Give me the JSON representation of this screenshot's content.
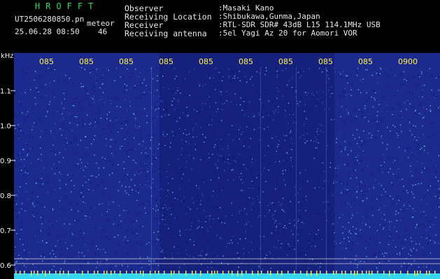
{
  "header": {
    "app_title": "HROFFT",
    "file_name": "UT2506280850.pn",
    "meteor_label": "meteor",
    "timestamp": "25.06.28 08:50",
    "meteor_count": "46",
    "info": [
      {
        "label": "Observer",
        "value": ":Masaki Kano"
      },
      {
        "label": "Receiving Location",
        "value": ":Shibukawa,Gunma,Japan"
      },
      {
        "label": "Receiver",
        "value": ":RTL-SDR SDR# 43dB L15 114.1MHz USB"
      },
      {
        "label": "Receiving antenna",
        "value": ":5el Yagi Az 20 for Aomori VOR"
      }
    ]
  },
  "chart_data": {
    "type": "heatmap",
    "ylabel": "kHz",
    "yticks": [
      1.1,
      1.0,
      0.9,
      0.8,
      0.7,
      0.6
    ],
    "ytick_labels": [
      "1.1",
      "1.0",
      "0.9",
      "0.8",
      "0.7",
      "0.6"
    ],
    "xtick_labels": [
      "085",
      "085",
      "085",
      "085",
      "085",
      "085",
      "085",
      "085",
      "085",
      "0900"
    ],
    "colors": {
      "background": "#1c2a8e",
      "speckle_light": "#5ec8e6",
      "speckle_dark": "#0a1060",
      "tick_text": "#fff04a",
      "axis_text": "#f2f2f2",
      "bottom_band": "#35d6f0"
    }
  }
}
